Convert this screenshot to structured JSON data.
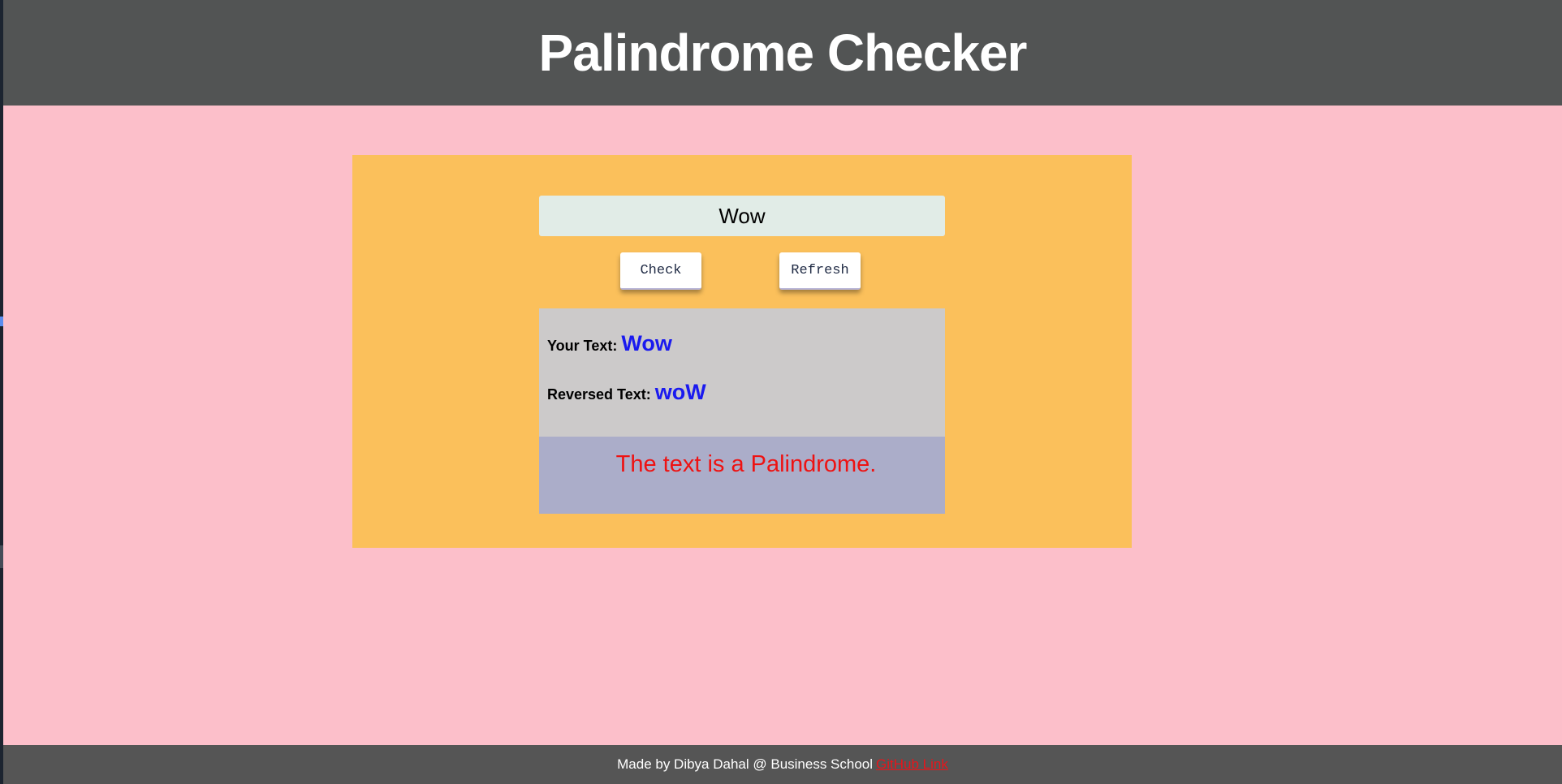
{
  "header": {
    "title": "Palindrome Checker"
  },
  "form": {
    "input_value": "Wow",
    "check_label": "Check",
    "refresh_label": "Refresh"
  },
  "result": {
    "your_text_label": "Your Text:",
    "your_text_value": "Wow",
    "reversed_label": "Reversed Text:",
    "reversed_value": "woW",
    "verdict": "The text is a Palindrome."
  },
  "footer": {
    "credit": "Made by Dibya Dahal @ Business School",
    "link_label": "GitHub Link"
  },
  "colors": {
    "page_background": "#fcbfca",
    "header_background": "#525454",
    "card_background": "#fbc05b",
    "input_background": "#e1ece7",
    "result_background": "#cccaca",
    "verdict_background": "#abadc9",
    "value_text": "#1a1aef",
    "verdict_text": "#ee1212",
    "link_text": "#e8151b"
  }
}
